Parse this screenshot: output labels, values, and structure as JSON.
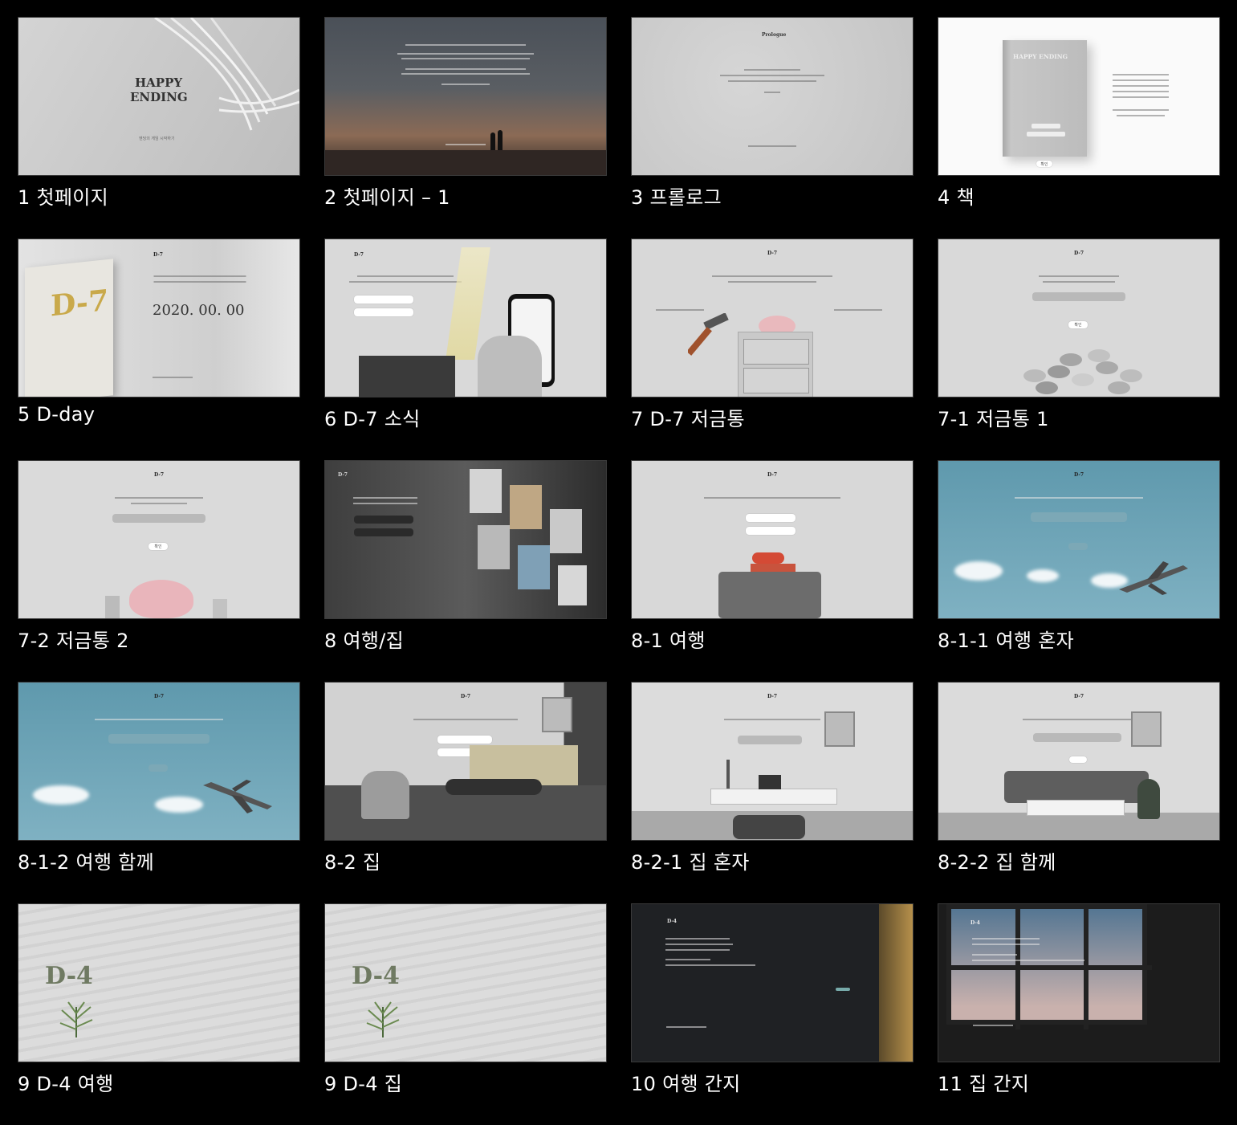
{
  "slides": [
    {
      "id": "s1",
      "caption": "1 첫페이지",
      "logo_line1": "HAPPY",
      "logo_line2": "ENDING",
      "start_label": "엔딩의 게임 시작하기"
    },
    {
      "id": "s2",
      "caption": "2 첫페이지 – 1"
    },
    {
      "id": "s3",
      "caption": "3 프롤로그",
      "heading": "Prologue"
    },
    {
      "id": "s4",
      "caption": "4 책",
      "book_title": "HAPPY ENDING",
      "confirm": "확인"
    },
    {
      "id": "s5",
      "caption": "5 D-day",
      "title": "D-7",
      "calendar_big": "D-7",
      "date": "2020. 00. 00"
    },
    {
      "id": "s6",
      "caption": "6 D-7 소식",
      "title": "D-7"
    },
    {
      "id": "s7",
      "caption": "7 D-7 저금통",
      "title": "D-7"
    },
    {
      "id": "s7_1",
      "caption": "7-1 저금통 1",
      "title": "D-7",
      "confirm": "확인"
    },
    {
      "id": "s7_2",
      "caption": "7-2 저금통 2",
      "title": "D-7",
      "confirm": "확인"
    },
    {
      "id": "s8",
      "caption": "8 여행/집",
      "title": "D-7"
    },
    {
      "id": "s8_1",
      "caption": "8-1 여행",
      "title": "D-7"
    },
    {
      "id": "s8_1_1",
      "caption": "8-1-1 여행 혼자",
      "title": "D-7"
    },
    {
      "id": "s8_1_2",
      "caption": "8-1-2 여행 함께",
      "title": "D-7"
    },
    {
      "id": "s8_2",
      "caption": "8-2 집",
      "title": "D-7"
    },
    {
      "id": "s8_2_1",
      "caption": "8-2-1 집 혼자",
      "title": "D-7"
    },
    {
      "id": "s8_2_2",
      "caption": "8-2-2 집 함께",
      "title": "D-7"
    },
    {
      "id": "s9a",
      "caption": "9 D-4 여행",
      "big": "D-4"
    },
    {
      "id": "s9b",
      "caption": "9 D-4 집",
      "big": "D-4"
    },
    {
      "id": "s10",
      "caption": "10 여행 간지",
      "title": "D-4"
    },
    {
      "id": "s11",
      "caption": "11 집 간지",
      "title": "D-4"
    }
  ]
}
